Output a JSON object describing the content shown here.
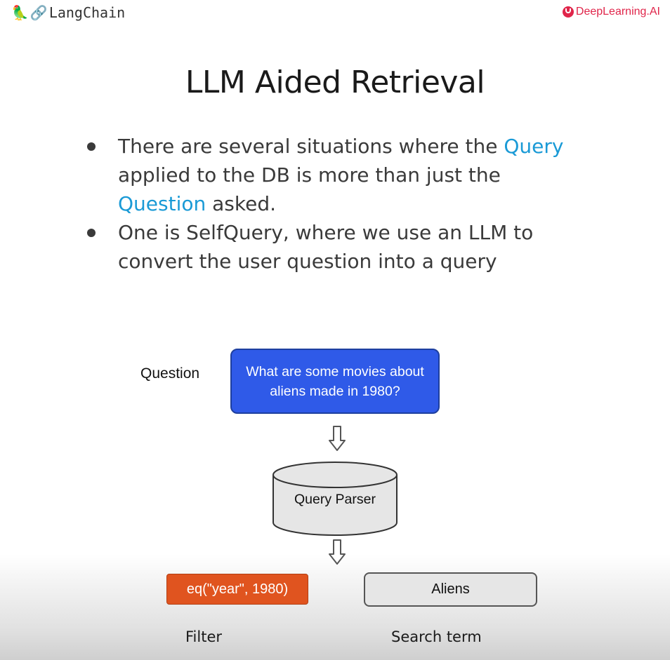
{
  "header": {
    "left_logo_text": "LangChain",
    "left_logo_icons": [
      "parrot-icon",
      "link-icon"
    ],
    "right_logo_text": "DeepLearning.AI",
    "right_logo_icon": "deeplearning-ai-icon"
  },
  "slide": {
    "title": "LLM Aided Retrieval",
    "bullets": [
      {
        "parts": [
          {
            "text": "There are several situations where the ",
            "highlight": false
          },
          {
            "text": "Query",
            "highlight": true
          },
          {
            "text": " applied to the DB is more than just the ",
            "highlight": false
          },
          {
            "text": "Question",
            "highlight": true
          },
          {
            "text": " asked.",
            "highlight": false
          }
        ]
      },
      {
        "parts": [
          {
            "text": "One is SelfQuery, where we use an LLM to convert the user question into a query",
            "highlight": false
          }
        ]
      }
    ],
    "highlight_color": "#1a9ad6"
  },
  "diagram": {
    "question_label": "Question",
    "question_text": "What are some movies about aliens made in 1980?",
    "parser_label": "Query Parser",
    "filter_text": "eq(\"year\", 1980)",
    "filter_label": "Filter",
    "search_term_text": "Aliens",
    "search_term_label": "Search term",
    "colors": {
      "question_box": "#2f5ae8",
      "filter_box": "#e0541f",
      "term_box": "#e6e6e6"
    }
  }
}
